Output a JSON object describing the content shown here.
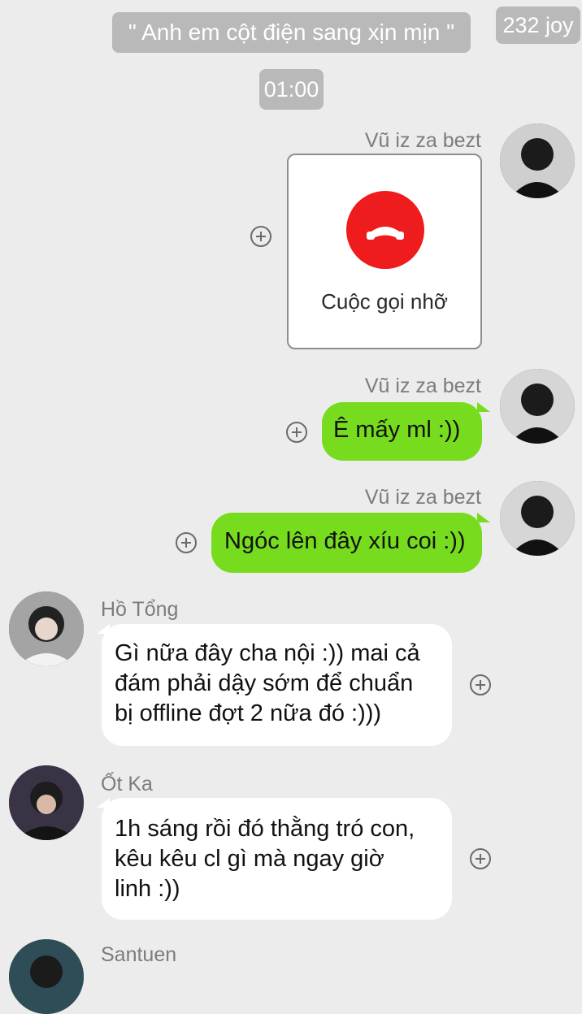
{
  "header": {
    "group_notice": "\" Anh em cột điện sang xịn mịn \"",
    "counter": "232 joy",
    "time": "01:00"
  },
  "messages": [
    {
      "sender": "Vũ iz za bezt",
      "type": "missed_call",
      "label": "Cuộc gọi nhỡ",
      "icon": "hang-up-phone-icon"
    },
    {
      "sender": "Vũ iz za bezt",
      "type": "text",
      "text": "Ê mấy ml :))"
    },
    {
      "sender": "Vũ iz za bezt",
      "type": "text",
      "text": "Ngóc lên đây xíu coi :))"
    },
    {
      "sender": "Hồ Tổng",
      "type": "text",
      "lines": [
        "Gì nữa đây cha nội :)) mai cả",
        "đám phải dậy sớm để chuẩn",
        "bị offline đợt 2 nữa đó :)))"
      ]
    },
    {
      "sender": "Ốt Ka",
      "type": "text",
      "lines": [
        "1h sáng rồi đó thằng tró con,",
        "kêu kêu cl gì mà ngay giờ",
        "linh :))"
      ]
    },
    {
      "sender": "Santuen",
      "type": "partial"
    }
  ],
  "colors": {
    "background": "#ececec",
    "outgoing_bubble": "#77dc1e",
    "incoming_bubble": "#ffffff",
    "notice_pill": "#b9b9b9",
    "missed_call": "#ee1c1c"
  }
}
